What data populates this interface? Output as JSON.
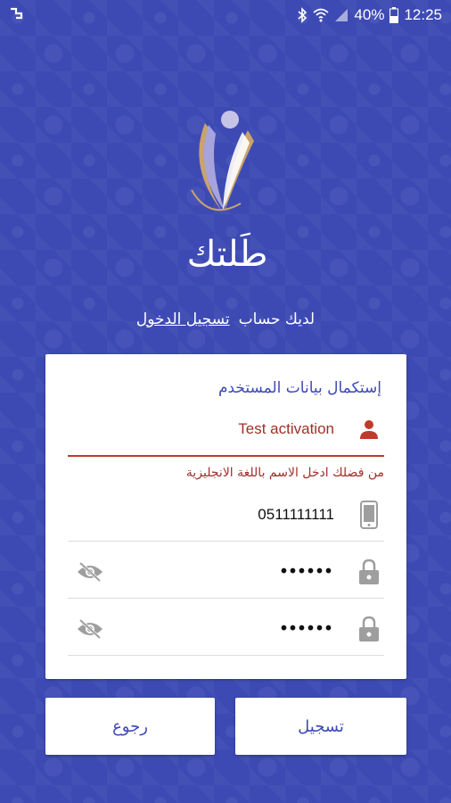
{
  "status_bar": {
    "battery_percent": "40%",
    "time": "12:25"
  },
  "brand": {
    "logo_text": "طَلتك"
  },
  "login_prompt": {
    "text": "لديك حساب",
    "link": "تسجيل الدخول"
  },
  "form": {
    "title": "إستكمال بيانات المستخدم",
    "name_value": "Test activation",
    "name_error": "من فضلك ادخل الاسم باللغة الانجليزية",
    "phone_value": "0511111111",
    "password_value": "••••••",
    "confirm_password_value": "••••••"
  },
  "buttons": {
    "back": "رجوع",
    "register": "تسجيل"
  },
  "colors": {
    "background": "#3d4ab4",
    "error": "#c0392b",
    "icon_gray": "#9e9e9e"
  }
}
